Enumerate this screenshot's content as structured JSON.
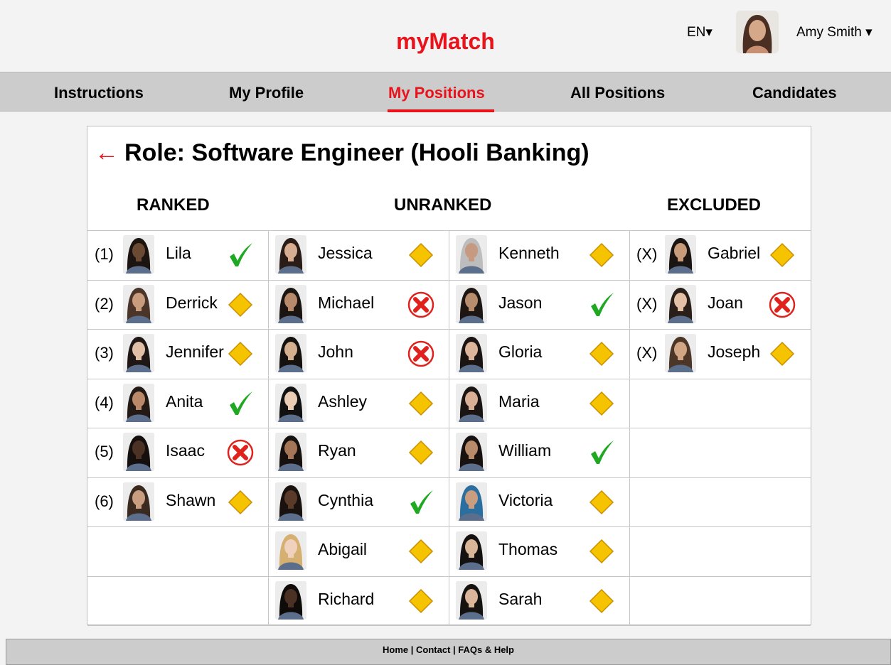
{
  "header": {
    "app_title": "myMatch",
    "language": "EN▾",
    "user_name": "Amy Smith ▾"
  },
  "nav": {
    "tabs": [
      "Instructions",
      "My Profile",
      "My Positions",
      "All Positions",
      "Candidates"
    ],
    "active_tab": "My Positions"
  },
  "role": {
    "back": "←",
    "title": "Role: Software Engineer (Hooli Banking)"
  },
  "columns": {
    "ranked": "RANKED",
    "unranked": "UNRANKED",
    "excluded": "EXCLUDED"
  },
  "ranked": [
    {
      "rank": "(1)",
      "name": "Lila",
      "status": "check",
      "skin": "#6b4a34",
      "hair": "#1c1410"
    },
    {
      "rank": "(2)",
      "name": "Derrick",
      "status": "diamond",
      "skin": "#c89c7c",
      "hair": "#4a3528"
    },
    {
      "rank": "(3)",
      "name": "Jennifer",
      "status": "diamond",
      "skin": "#e1bfa6",
      "hair": "#1e1715"
    },
    {
      "rank": "(4)",
      "name": "Anita",
      "status": "check",
      "skin": "#b98969",
      "hair": "#231a16"
    },
    {
      "rank": "(5)",
      "name": "Isaac",
      "status": "cross",
      "skin": "#4c3224",
      "hair": "#15100d"
    },
    {
      "rank": "(6)",
      "name": "Shawn",
      "status": "diamond",
      "skin": "#c99d80",
      "hair": "#3b2a20"
    }
  ],
  "unranked_a": [
    {
      "name": "Jessica",
      "status": "diamond",
      "skin": "#d7ae92",
      "hair": "#2a1d17"
    },
    {
      "name": "Michael",
      "status": "cross",
      "skin": "#b88a6c",
      "hair": "#1b1512"
    },
    {
      "name": "John",
      "status": "cross",
      "skin": "#d5b08f",
      "hair": "#15110f"
    },
    {
      "name": "Ashley",
      "status": "diamond",
      "skin": "#ebcdb6",
      "hair": "#111"
    },
    {
      "name": "Ryan",
      "status": "diamond",
      "skin": "#a47657",
      "hair": "#16110e"
    },
    {
      "name": "Cynthia",
      "status": "check",
      "skin": "#5a3b2a",
      "hair": "#19120f"
    },
    {
      "name": "Abigail",
      "status": "diamond",
      "skin": "#efd1bd",
      "hair": "#d6b070"
    },
    {
      "name": "Richard",
      "status": "diamond",
      "skin": "#4b3124",
      "hair": "#0f0b09"
    }
  ],
  "unranked_b": [
    {
      "name": "Kenneth",
      "status": "diamond",
      "skin": "#c69a80",
      "hair": "#bdbdbd"
    },
    {
      "name": "Jason",
      "status": "check",
      "skin": "#b88d6e",
      "hair": "#1d1613"
    },
    {
      "name": "Gloria",
      "status": "diamond",
      "skin": "#dcb59b",
      "hair": "#1a1412"
    },
    {
      "name": "Maria",
      "status": "diamond",
      "skin": "#d9b095",
      "hair": "#1a1412"
    },
    {
      "name": "William",
      "status": "check",
      "skin": "#b78a6a",
      "hair": "#17120f"
    },
    {
      "name": "Victoria",
      "status": "diamond",
      "skin": "#c99d80",
      "hair": "#2b6fa0"
    },
    {
      "name": "Thomas",
      "status": "diamond",
      "skin": "#d9b697",
      "hair": "#141110"
    },
    {
      "name": "Sarah",
      "status": "diamond",
      "skin": "#dbb59a",
      "hair": "#161210"
    }
  ],
  "excluded": [
    {
      "rank": "(X)",
      "name": "Gabriel",
      "status": "diamond",
      "skin": "#c89b7b",
      "hair": "#1a1412"
    },
    {
      "rank": "(X)",
      "name": "Joan",
      "status": "cross",
      "skin": "#e3c0a6",
      "hair": "#2a1e18"
    },
    {
      "rank": "(X)",
      "name": "Joseph",
      "status": "diamond",
      "skin": "#d0a685",
      "hair": "#4b3628"
    }
  ],
  "footer": {
    "links": [
      "Home",
      "Contact",
      "FAQs & Help"
    ],
    "separator": " | "
  },
  "colors": {
    "brand_red": "#e8131b",
    "check_green": "#1fa822",
    "diamond_yellow": "#f6c300",
    "cross_red": "#e0221c"
  }
}
